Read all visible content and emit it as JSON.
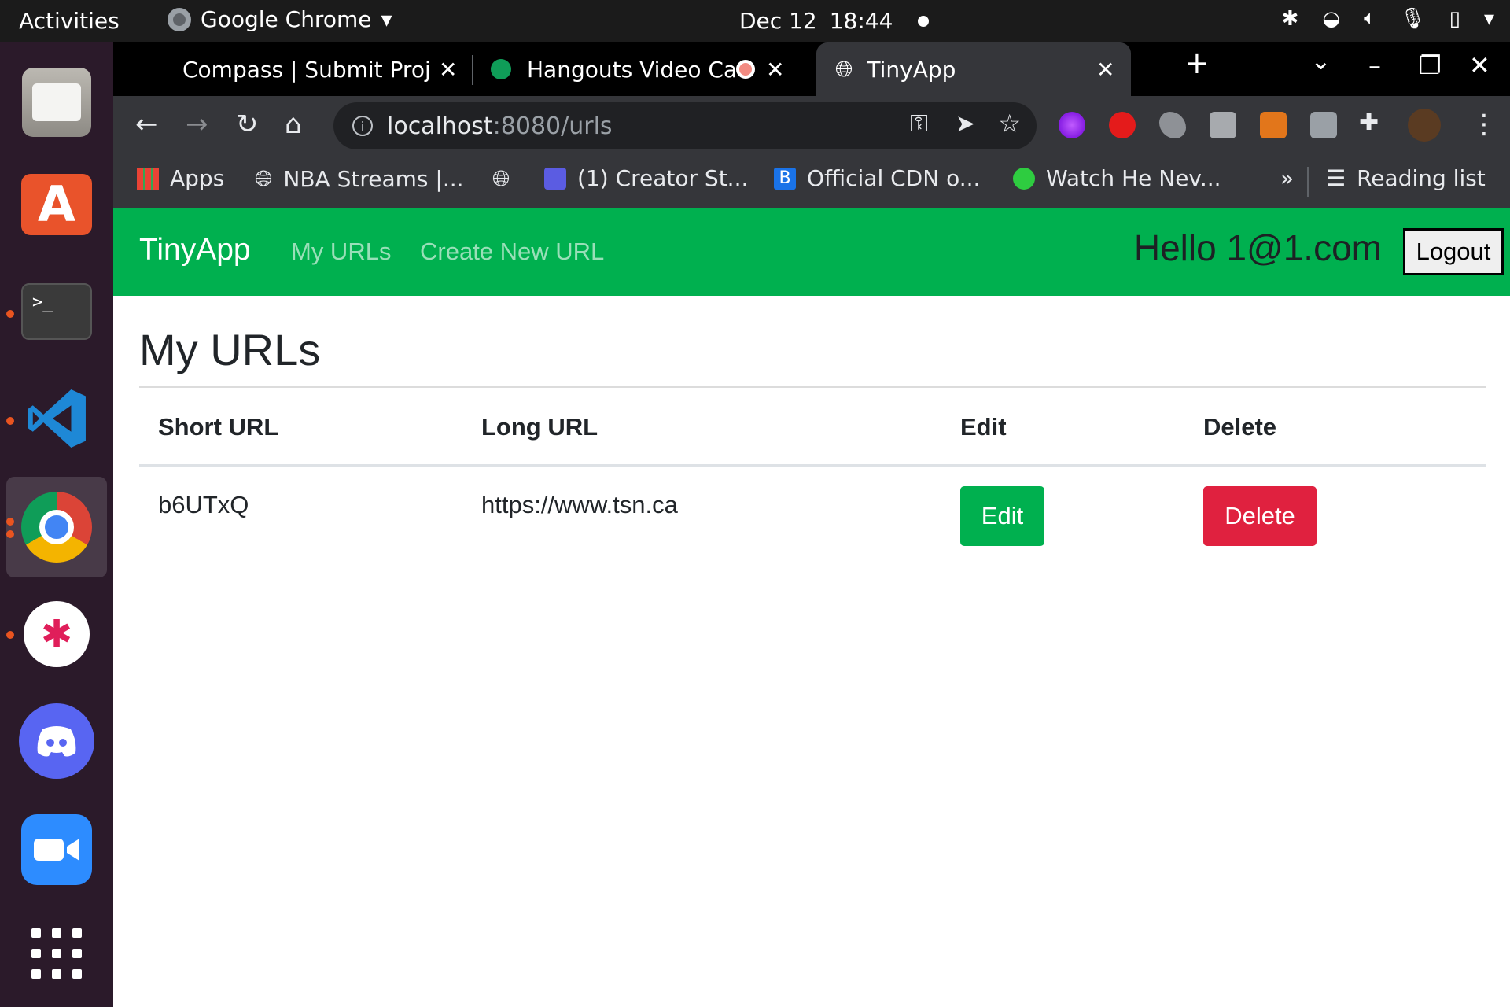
{
  "system_bar": {
    "activities": "Activities",
    "app_name": "Google Chrome",
    "date": "Dec 12",
    "time": "18:44"
  },
  "dock": {
    "items": [
      "files-icon",
      "software-store-icon",
      "terminal-icon",
      "vscode-icon",
      "chrome-icon",
      "slack-icon",
      "discord-icon",
      "zoom-icon",
      "app-grid-icon"
    ],
    "terminal_glyph": ">_",
    "store_glyph": "A"
  },
  "tabs": [
    {
      "title": "Compass | Submit Proje",
      "close": "✕"
    },
    {
      "title": "Hangouts Video Ca",
      "close": "✕"
    },
    {
      "title": "TinyApp",
      "close": "✕"
    }
  ],
  "window_controls": {
    "new_tab": "+",
    "tab_search": "⌄",
    "minimize": "–",
    "maximize": "❐",
    "close": "✕"
  },
  "toolbar": {
    "back": "←",
    "forward": "→",
    "reload": "↻",
    "home": "⌂",
    "url_host": "localhost",
    "url_path": ":8080/urls",
    "key_icon": "⚿",
    "send_icon": "➤",
    "star_icon": "☆",
    "menu_icon": "⋮"
  },
  "bookmarks": {
    "items": [
      {
        "label": "Apps"
      },
      {
        "label": "NBA Streams |..."
      },
      {
        "label": ""
      },
      {
        "label": "(1) Creator St..."
      },
      {
        "label": "Official CDN o..."
      },
      {
        "label": "Watch He Nev..."
      }
    ],
    "more": "»",
    "reading_list": "Reading list",
    "cdn_glyph": "B"
  },
  "navbar": {
    "brand": "TinyApp",
    "links": [
      "My URLs",
      "Create New URL"
    ],
    "greeting": "Hello 1@1.com",
    "logout_label": "Logout"
  },
  "main": {
    "title": "My URLs",
    "table": {
      "headers": [
        "Short URL",
        "Long URL",
        "Edit",
        "Delete"
      ],
      "rows": [
        {
          "short_url": "b6UTxQ",
          "long_url": "https://www.tsn.ca",
          "edit_label": "Edit",
          "delete_label": "Delete"
        }
      ]
    }
  },
  "colors": {
    "navbar_bg": "#00b04f",
    "edit_button": "#00b04f",
    "delete_button": "#e0213f",
    "dock_bg": "#2b1a2a",
    "chrome_toolbar": "#35363a"
  }
}
